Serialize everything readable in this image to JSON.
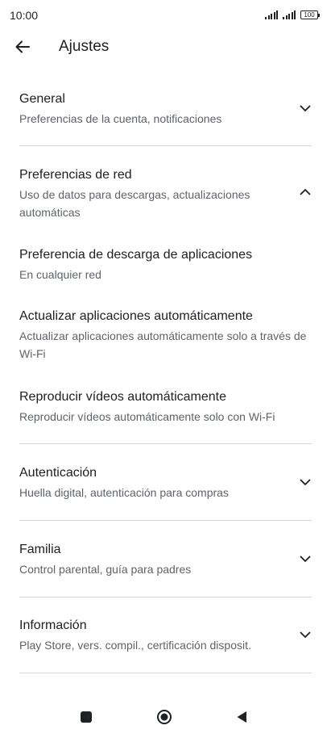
{
  "status_bar": {
    "time": "10:00",
    "battery": "100"
  },
  "header": {
    "title": "Ajustes"
  },
  "settings": {
    "general": {
      "title": "General",
      "subtitle": "Preferencias de la cuenta, notificaciones",
      "expanded": false
    },
    "network": {
      "title": "Preferencias de red",
      "subtitle": "Uso de datos para descargas, actualizaciones automáticas",
      "expanded": true,
      "options": [
        {
          "title": "Preferencia de descarga de aplicaciones",
          "subtitle": "En cualquier red"
        },
        {
          "title": "Actualizar aplicaciones automáticamente",
          "subtitle": "Actualizar aplicaciones automáticamente solo a través de Wi-Fi"
        },
        {
          "title": "Reproducir vídeos automáticamente",
          "subtitle": "Reproducir vídeos automáticamente solo con Wi-Fi"
        }
      ]
    },
    "auth": {
      "title": "Autenticación",
      "subtitle": "Huella digital, autenticación para compras",
      "expanded": false
    },
    "family": {
      "title": "Familia",
      "subtitle": "Control parental, guía para padres",
      "expanded": false
    },
    "info": {
      "title": "Información",
      "subtitle": "Play Store, vers. compil., certificación disposit.",
      "expanded": false
    }
  },
  "icons": {
    "back": "arrow-back-icon",
    "expand": "chevron-down-icon",
    "collapse": "chevron-up-icon",
    "nav": [
      "square-icon",
      "circle-home-icon",
      "triangle-back-icon"
    ]
  },
  "colors": {
    "text_primary": "#202124",
    "text_secondary": "#5f6368",
    "divider": "#d5d7db"
  }
}
